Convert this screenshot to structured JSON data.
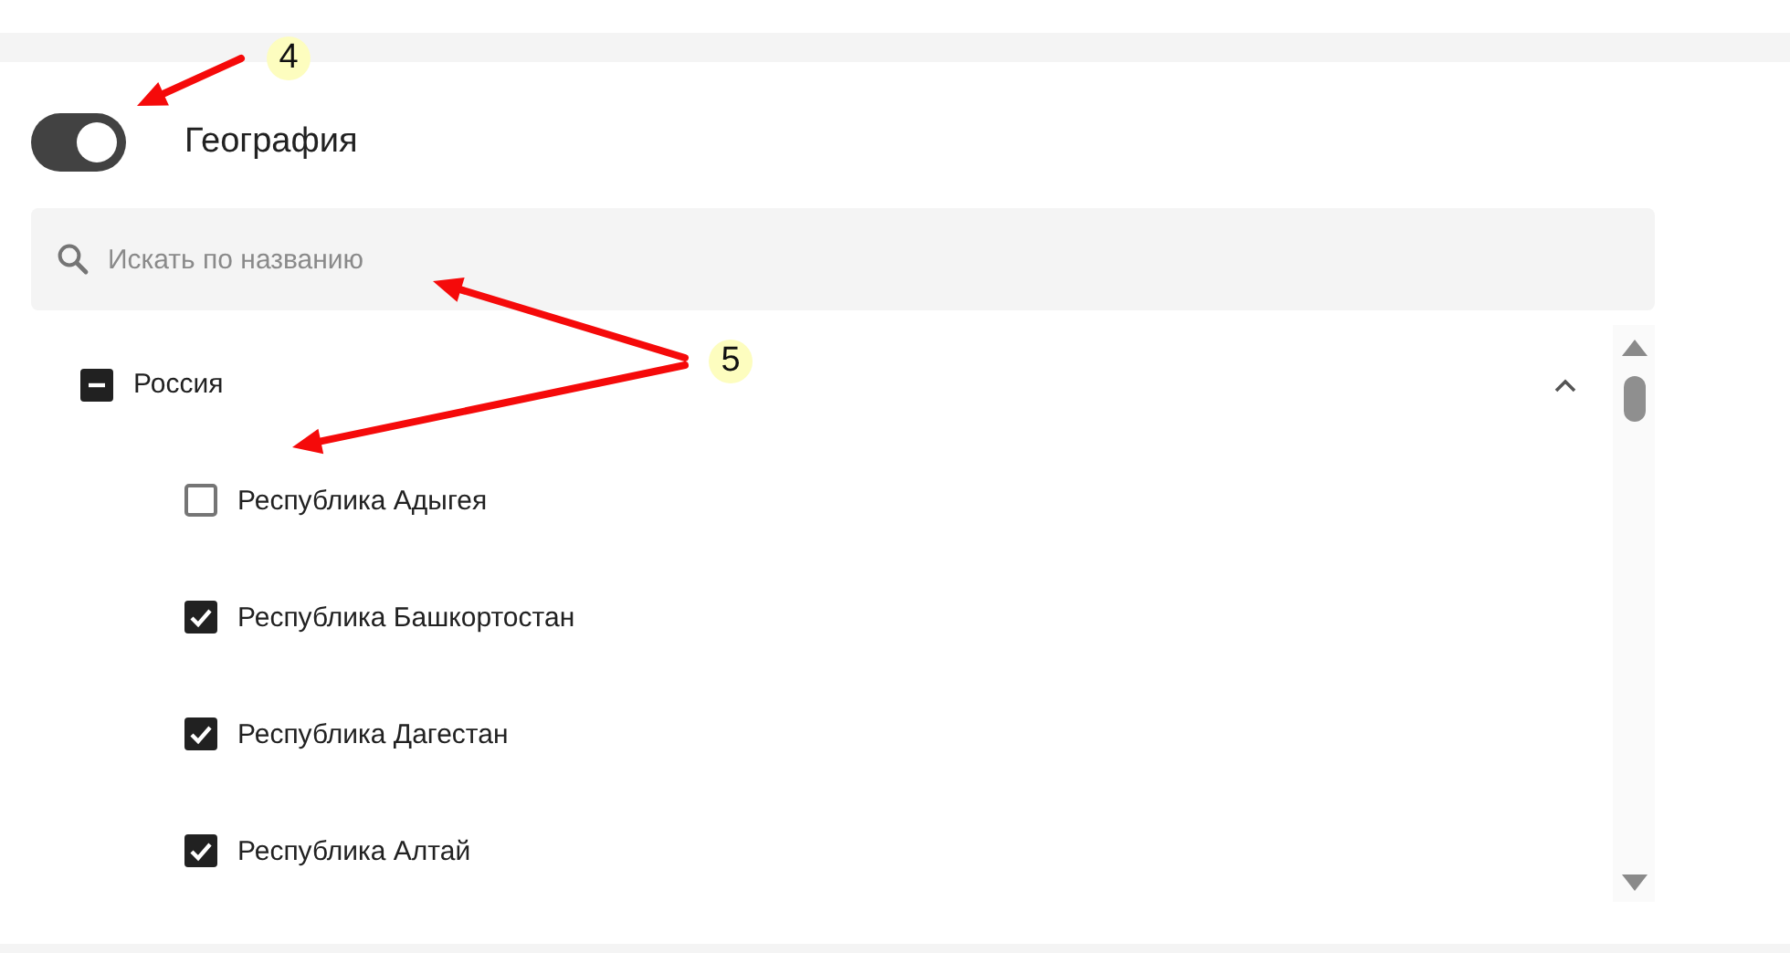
{
  "section": {
    "title": "География",
    "toggle": {
      "on": true
    }
  },
  "search": {
    "placeholder": "Искать по названию"
  },
  "tree": [
    {
      "label": "Россия",
      "checked": false,
      "indeterminate": true,
      "expanded": true,
      "children": [
        {
          "label": "Республика Адыгея",
          "checked": false,
          "indeterminate": false
        },
        {
          "label": "Республика Башкортостан",
          "checked": true,
          "indeterminate": false
        },
        {
          "label": "Республика Дагестан",
          "checked": true,
          "indeterminate": false
        },
        {
          "label": "Республика Алтай",
          "checked": true,
          "indeterminate": false
        }
      ]
    }
  ],
  "annotations": [
    {
      "label": "4"
    },
    {
      "label": "5"
    }
  ]
}
